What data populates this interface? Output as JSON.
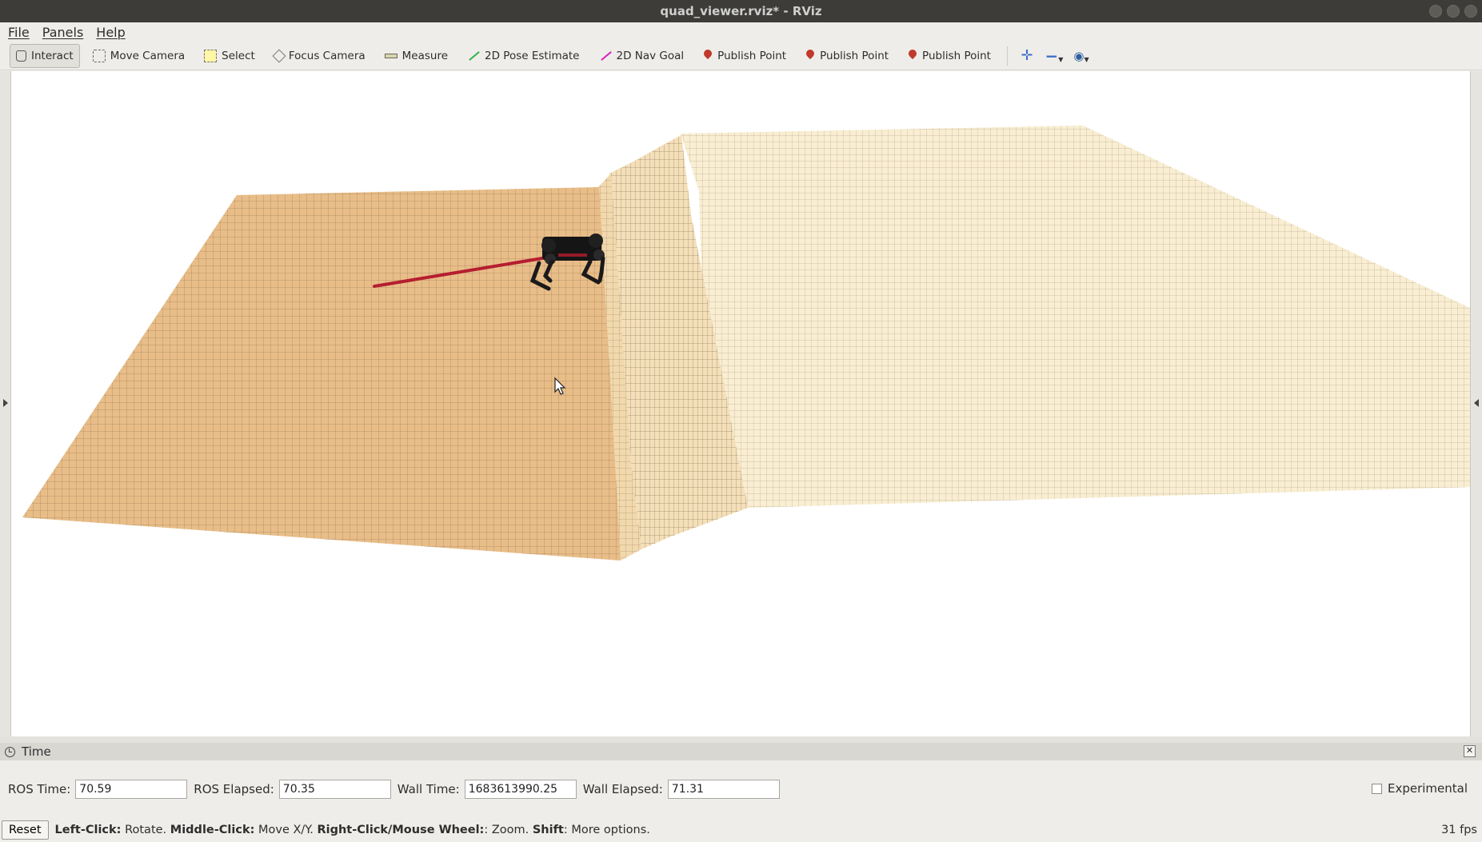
{
  "window": {
    "title": "quad_viewer.rviz* - RViz"
  },
  "menu": [
    "File",
    "Panels",
    "Help"
  ],
  "toolbar": {
    "tools": [
      {
        "label": "Interact",
        "icon": "hand-icon"
      },
      {
        "label": "Move Camera",
        "icon": "move-camera-icon"
      },
      {
        "label": "Select",
        "icon": "select-icon"
      },
      {
        "label": "Focus Camera",
        "icon": "focus-camera-icon"
      },
      {
        "label": "Measure",
        "icon": "measure-icon"
      },
      {
        "label": "2D Pose Estimate",
        "icon": "pose-arrow-icon"
      },
      {
        "label": "2D Nav Goal",
        "icon": "nav-goal-arrow-icon"
      },
      {
        "label": "Publish Point",
        "icon": "map-pin-icon"
      },
      {
        "label": "Publish Point",
        "icon": "map-pin-icon"
      },
      {
        "label": "Publish Point",
        "icon": "map-pin-icon"
      }
    ],
    "active_tool": "Interact",
    "extra_icons": [
      "plus-icon",
      "minus-icon",
      "eye-icon"
    ]
  },
  "scene": {
    "terrain_color_low": "#e9bd88",
    "terrain_color_high": "#f8ecce",
    "grid_color": "#4a4030",
    "path_color": "#b51e30",
    "robot_color": "#151515"
  },
  "time_panel": {
    "title": "Time",
    "ros_time_label": "ROS Time:",
    "ros_time": "70.59",
    "ros_elapsed_label": "ROS Elapsed:",
    "ros_elapsed": "70.35",
    "wall_time_label": "Wall Time:",
    "wall_time": "1683613990.25",
    "wall_elapsed_label": "Wall Elapsed:",
    "wall_elapsed": "71.31",
    "experimental_label": "Experimental",
    "experimental_checked": false
  },
  "statusbar": {
    "reset_label": "Reset",
    "hint_parts": [
      {
        "bold": true,
        "text": "Left-Click:"
      },
      {
        "bold": false,
        "text": " Rotate. "
      },
      {
        "bold": true,
        "text": "Middle-Click:"
      },
      {
        "bold": false,
        "text": " Move X/Y. "
      },
      {
        "bold": true,
        "text": "Right-Click/Mouse Wheel:"
      },
      {
        "bold": false,
        "text": ": Zoom. "
      },
      {
        "bold": true,
        "text": "Shift"
      },
      {
        "bold": false,
        "text": ": More options."
      }
    ],
    "fps": "31 fps"
  }
}
